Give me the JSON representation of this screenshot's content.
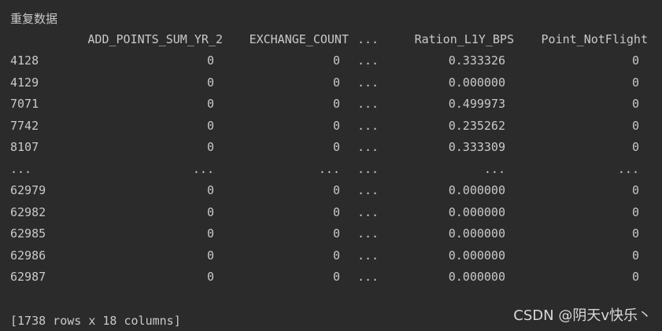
{
  "console": {
    "title": "重复数据",
    "columns": {
      "add_points": "ADD_POINTS_SUM_YR_2",
      "exchange": "EXCHANGE_COUNT",
      "dots": "...",
      "ratio": "Ration_L1Y_BPS",
      "point": "Point_NotFlight"
    },
    "rows": [
      {
        "index": "4128",
        "add_points": "0",
        "exchange": "0",
        "dots": "...",
        "ratio": "0.333326",
        "point": "0"
      },
      {
        "index": "4129",
        "add_points": "0",
        "exchange": "0",
        "dots": "...",
        "ratio": "0.000000",
        "point": "0"
      },
      {
        "index": "7071",
        "add_points": "0",
        "exchange": "0",
        "dots": "...",
        "ratio": "0.499973",
        "point": "0"
      },
      {
        "index": "7742",
        "add_points": "0",
        "exchange": "0",
        "dots": "...",
        "ratio": "0.235262",
        "point": "0"
      },
      {
        "index": "8107",
        "add_points": "0",
        "exchange": "0",
        "dots": "...",
        "ratio": "0.333309",
        "point": "0"
      },
      {
        "index": "...",
        "add_points": "...",
        "exchange": "...",
        "dots": "...",
        "ratio": "...",
        "point": "..."
      },
      {
        "index": "62979",
        "add_points": "0",
        "exchange": "0",
        "dots": "...",
        "ratio": "0.000000",
        "point": "0"
      },
      {
        "index": "62982",
        "add_points": "0",
        "exchange": "0",
        "dots": "...",
        "ratio": "0.000000",
        "point": "0"
      },
      {
        "index": "62985",
        "add_points": "0",
        "exchange": "0",
        "dots": "...",
        "ratio": "0.000000",
        "point": "0"
      },
      {
        "index": "62986",
        "add_points": "0",
        "exchange": "0",
        "dots": "...",
        "ratio": "0.000000",
        "point": "0"
      },
      {
        "index": "62987",
        "add_points": "0",
        "exchange": "0",
        "dots": "...",
        "ratio": "0.000000",
        "point": "0"
      }
    ],
    "footer": "[1738 rows x 18 columns]",
    "watermark": "CSDN @阴天v快乐丶"
  },
  "colors": {
    "background": "#2b2b2b",
    "text": "#c9c9c9"
  }
}
